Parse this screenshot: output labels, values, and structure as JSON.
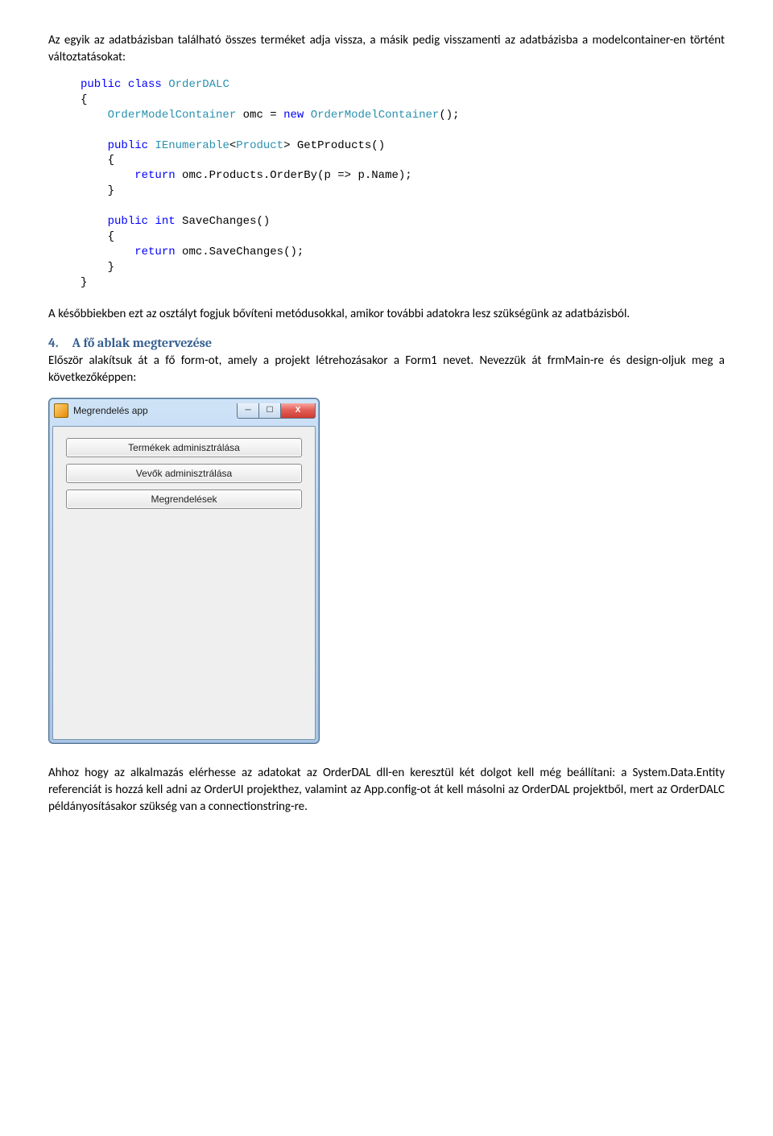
{
  "para1": "Az egyik az adatbázisban található összes terméket adja vissza, a másik pedig visszamenti az adatbázisba a modelcontainer-en történt változtatásokat:",
  "code": {
    "l01a": "public",
    "l01b": "class",
    "l01c": "OrderDALC",
    "l02": "{",
    "l03a": "    ",
    "l03b": "OrderModelContainer",
    "l03c": " omc = ",
    "l03d": "new",
    "l03e": " ",
    "l03f": "OrderModelContainer",
    "l03g": "();",
    "l05a": "    ",
    "l05b": "public",
    "l05c": " ",
    "l05d": "IEnumerable",
    "l05e": "<",
    "l05f": "Product",
    "l05g": "> GetProducts()",
    "l06": "    {",
    "l07a": "        ",
    "l07b": "return",
    "l07c": " omc.Products.OrderBy(p => p.Name);",
    "l08": "    }",
    "l10a": "    ",
    "l10b": "public",
    "l10c": " ",
    "l10d": "int",
    "l10e": " SaveChanges()",
    "l11": "    {",
    "l12a": "        ",
    "l12b": "return",
    "l12c": " omc.SaveChanges();",
    "l13": "    }",
    "l14": "}"
  },
  "para2": "A későbbiekben ezt az osztályt fogjuk bővíteni metódusokkal, amikor további adatokra lesz szükségünk az adatbázisból.",
  "heading4": {
    "num": "4.",
    "text": "A fő ablak megtervezése"
  },
  "para3": "Először alakítsuk át a fő form-ot, amely a projekt létrehozásakor a Form1 nevet. Nevezzük át frmMain-re és design-oljuk meg a következőképpen:",
  "window": {
    "title": "Megrendelés app",
    "buttons": {
      "b1": "Termékek adminisztrálása",
      "b2": "Vevők adminisztrálása",
      "b3": "Megrendelések"
    },
    "min_glyph": "─",
    "max_glyph": "☐",
    "close_glyph": "X"
  },
  "para4": "Ahhoz hogy az alkalmazás elérhesse az adatokat az OrderDAL dll-en keresztül két dolgot kell még beállítani: a System.Data.Entity referenciát is hozzá kell adni az OrderUI projekthez, valamint az App.config-ot át kell másolni az OrderDAL projektből, mert az OrderDALC példányosításakor szükség van a connectionstring-re."
}
